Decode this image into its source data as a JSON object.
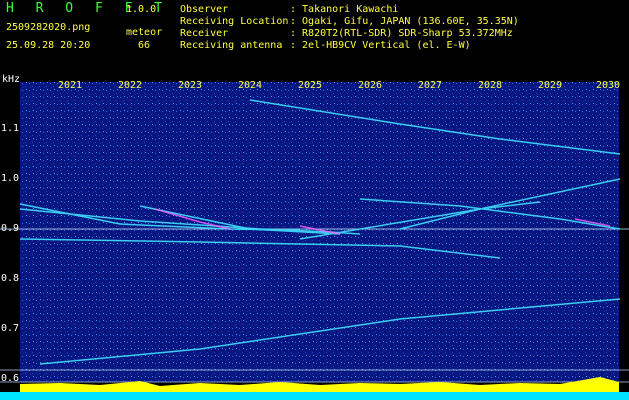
{
  "header": {
    "brand": "H R O F F T",
    "version": "1.0.0",
    "filename": "2509282020.png",
    "meteor_label": "meteor",
    "datetime": "25.09.28 20:20",
    "meteor_count": "66"
  },
  "info": [
    {
      "key": "Observer",
      "value": ": Takanori Kawachi"
    },
    {
      "key": "Receiving Location",
      "value": ": Ogaki, Gifu, JAPAN (136.60E, 35.35N)"
    },
    {
      "key": "Receiver",
      "value": ": R820T2(RTL-SDR) SDR-Sharp 53.372MHz"
    },
    {
      "key": "Receiving antenna",
      "value": ": 2el-HB9CV Vertical (el. E-W)"
    }
  ],
  "axes": {
    "y_unit": "kHz",
    "y_ticks": [
      "1.1",
      "1.0",
      "0.9",
      "0.8",
      "0.7",
      "0.6"
    ],
    "x_ticks": [
      "2021",
      "2022",
      "2023",
      "2024",
      "2025",
      "2026",
      "2027",
      "2028",
      "2029",
      "2030"
    ]
  },
  "colors": {
    "background": "#000000",
    "noise_field": "#0a1a8a",
    "trace": "#40e0ff",
    "hot_trace": "#ff60ff",
    "reference_line": "#c0e0ff",
    "bottom_bar": "#ffff00",
    "bottom_base": "#00e5ff"
  }
}
